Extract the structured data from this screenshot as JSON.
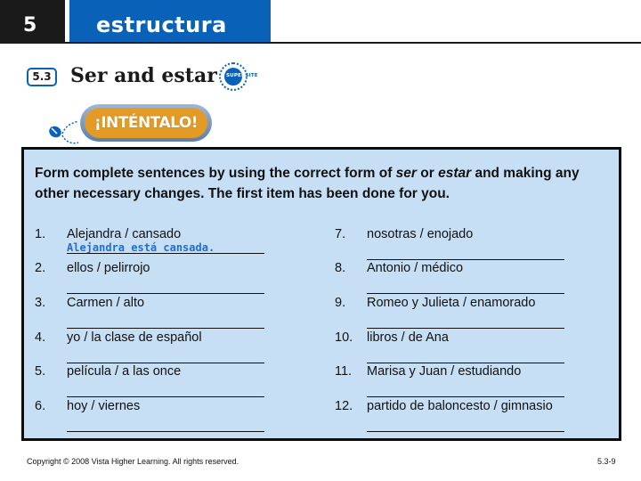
{
  "header": {
    "chapter_number": "5",
    "section_name": "estructura"
  },
  "lesson": {
    "number": "5.3",
    "title": "Ser and estar",
    "supersite_badge": {
      "left": "SUPER",
      "right": "SITE"
    }
  },
  "activity": {
    "banner": "¡INTÉNTALO!",
    "instructions_parts": {
      "part1": "Form complete sentences by using the correct form of ",
      "ser": "ser",
      "or": " or ",
      "estar": "estar",
      "part2": " and making any other necessary changes. The first item has been done for you."
    },
    "items": [
      {
        "number": "1.",
        "prompt": "Alejandra / cansado",
        "answer": "Alejandra está cansada."
      },
      {
        "number": "2.",
        "prompt": "ellos / pelirrojo",
        "answer": ""
      },
      {
        "number": "3.",
        "prompt": "Carmen / alto",
        "answer": ""
      },
      {
        "number": "4.",
        "prompt": "yo / la clase de español",
        "answer": ""
      },
      {
        "number": "5.",
        "prompt": "película / a las once",
        "answer": ""
      },
      {
        "number": "6.",
        "prompt": "hoy / viernes",
        "answer": ""
      },
      {
        "number": "7.",
        "prompt": "nosotras / enojado",
        "answer": ""
      },
      {
        "number": "8.",
        "prompt": "Antonio / médico",
        "answer": ""
      },
      {
        "number": "9.",
        "prompt": "Romeo y Julieta / enamorado",
        "answer": ""
      },
      {
        "number": "10.",
        "prompt": "libros / de Ana",
        "answer": ""
      },
      {
        "number": "11.",
        "prompt": "Marisa y Juan / estudiando",
        "answer": ""
      },
      {
        "number": "12.",
        "prompt": "partido de baloncesto / gimnasio",
        "answer": ""
      }
    ]
  },
  "footer": {
    "copyright": "Copyright © 2008 Vista Higher Learning. All rights reserved.",
    "page_number": "5.3-9"
  },
  "colors": {
    "brand_blue": "#0a62b8",
    "activity_bg": "#c7dff5",
    "answer_blue": "#1f6fd6",
    "banner_orange": "#e39b25"
  }
}
